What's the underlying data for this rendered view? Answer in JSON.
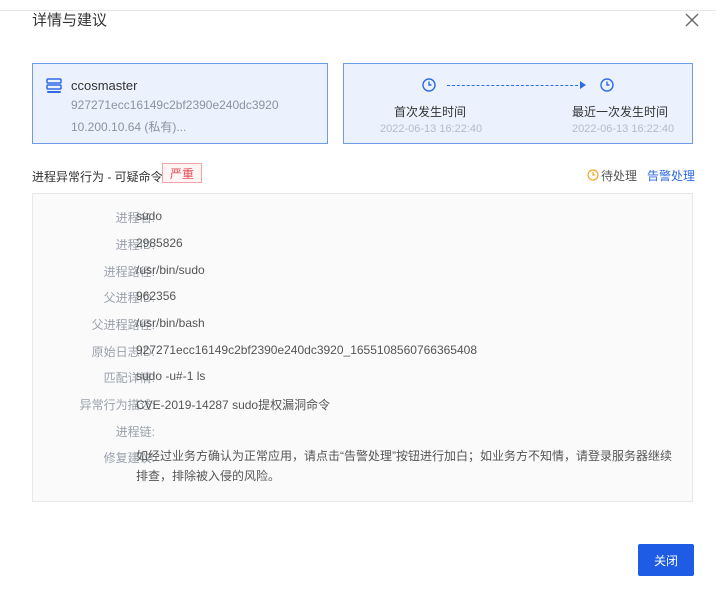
{
  "dialog": {
    "title": "详情与建议",
    "close_button": "关闭"
  },
  "host": {
    "name": "ccosmaster",
    "id": "927271ecc16149c2bf2390e240dc3920",
    "ip": "10.200.10.64 (私有)..."
  },
  "timeline": {
    "first_label": "首次发生时间",
    "first_value": "2022-06-13 16:22:40",
    "last_label": "最近一次发生时间",
    "last_value": "2022-06-13 16:22:40"
  },
  "event": {
    "title": "进程异常行为 - 可疑命令",
    "severity": "严重",
    "status": "待处理",
    "action_link": "告警处理"
  },
  "details": [
    {
      "key": "进程名:",
      "value": "sudo"
    },
    {
      "key": "进程ID:",
      "value": "2985826"
    },
    {
      "key": "进程路径:",
      "value": "/usr/bin/sudo"
    },
    {
      "key": "父进程ID:",
      "value": "962356"
    },
    {
      "key": "父进程路径:",
      "value": "/usr/bin/bash"
    },
    {
      "key": "原始日志ID:",
      "value": "927271ecc16149c2bf2390e240dc3920_1655108560766365408"
    },
    {
      "key": "匹配详情:",
      "value": "sudo -u#-1 ls"
    },
    {
      "key": "异常行为描述:",
      "value": "CVE-2019-14287 sudo提权漏洞命令"
    },
    {
      "key": "进程链:",
      "value": ""
    },
    {
      "key": "修复建议:",
      "value": "如经过业务方确认为正常应用，请点击“告警处理”按钮进行加白；如业务方不知情，请登录服务器继续排查，排除被入侵的风险。"
    }
  ]
}
